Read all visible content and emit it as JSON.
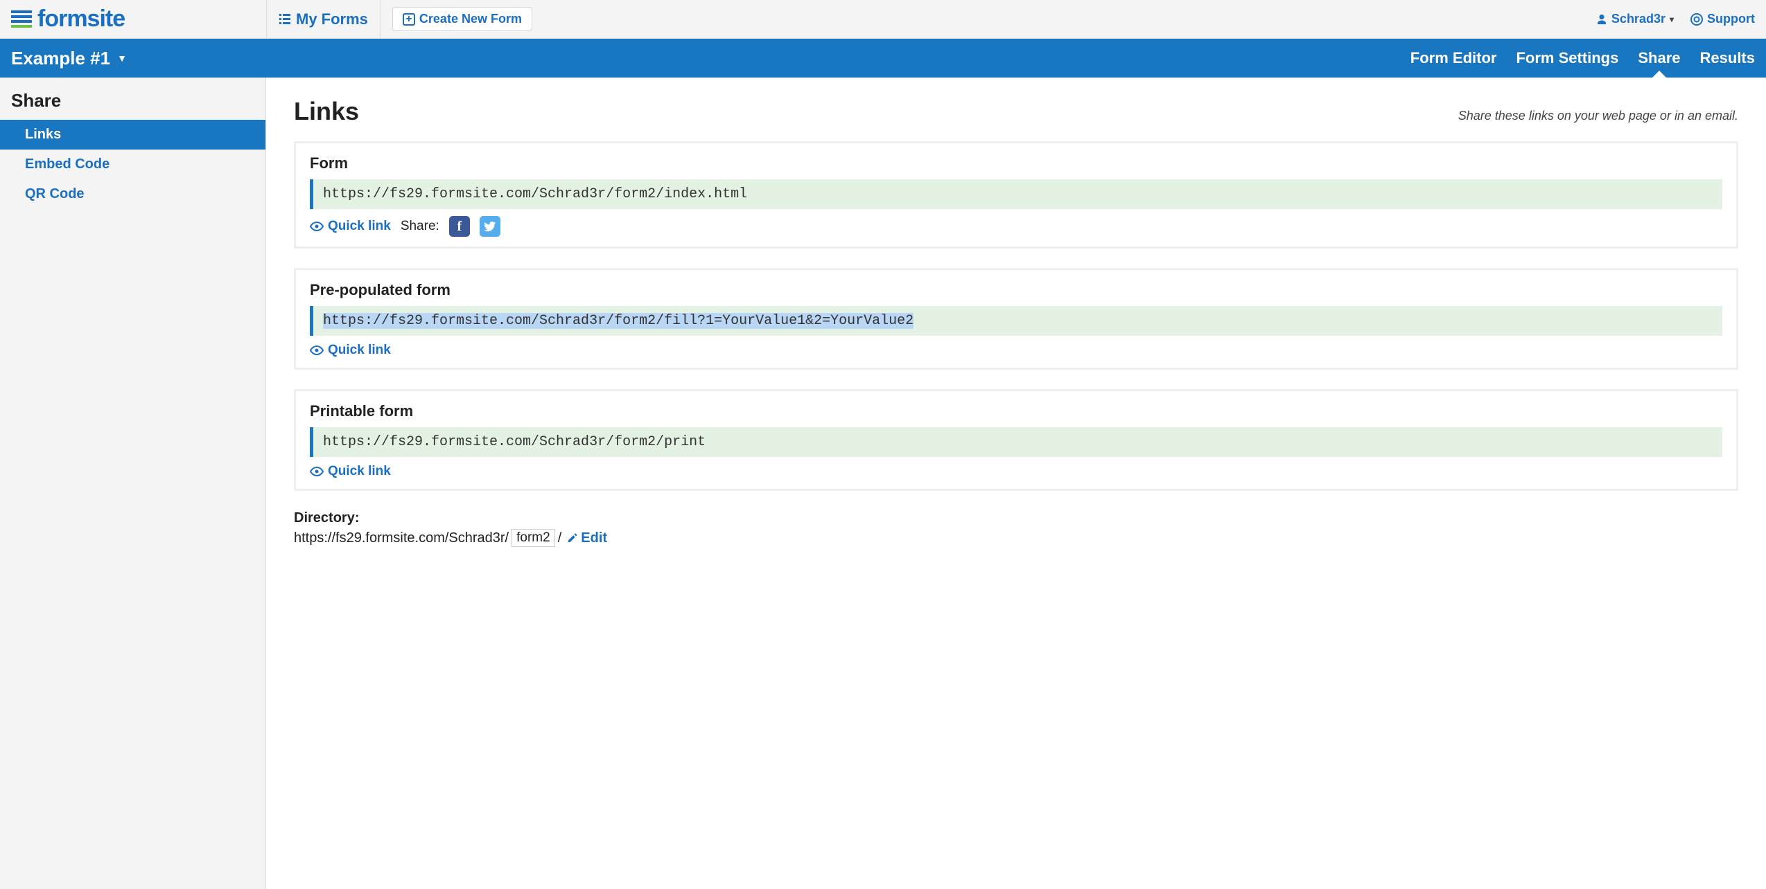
{
  "brand": "formsite",
  "topnav": {
    "my_forms": "My Forms",
    "create": "Create New Form",
    "user": "Schrad3r",
    "support": "Support"
  },
  "bluebar": {
    "form_name": "Example #1",
    "tabs": {
      "editor": "Form Editor",
      "settings": "Form Settings",
      "share": "Share",
      "results": "Results"
    },
    "active": "share"
  },
  "sidebar": {
    "title": "Share",
    "items": [
      {
        "label": "Links",
        "active": true
      },
      {
        "label": "Embed Code",
        "active": false
      },
      {
        "label": "QR Code",
        "active": false
      }
    ]
  },
  "main": {
    "title": "Links",
    "hint": "Share these links on your web page or in an email.",
    "quick_link": "Quick link",
    "share_label": "Share:",
    "cards": {
      "form": {
        "title": "Form",
        "url": "https://fs29.formsite.com/Schrad3r/form2/index.html"
      },
      "prepop": {
        "title": "Pre-populated form",
        "url": "https://fs29.formsite.com/Schrad3r/form2/fill?1=YourValue1&2=YourValue2"
      },
      "print": {
        "title": "Printable form",
        "url": "https://fs29.formsite.com/Schrad3r/form2/print"
      }
    },
    "directory": {
      "label": "Directory:",
      "base": "https://fs29.formsite.com/Schrad3r/",
      "slug": "form2",
      "trail": "/",
      "edit": "Edit"
    }
  }
}
